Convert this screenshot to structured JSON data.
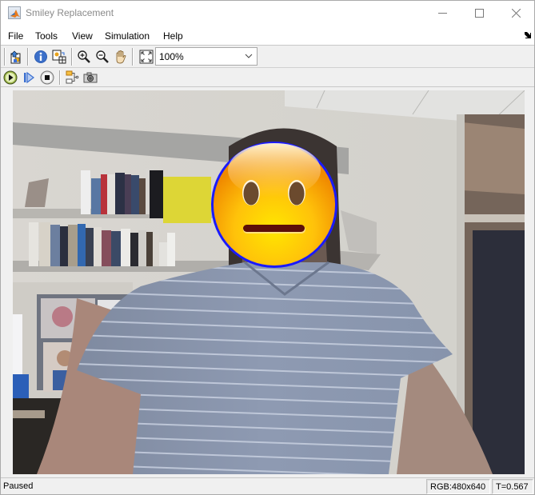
{
  "window": {
    "title": "Smiley Replacement",
    "controls": [
      "minimize",
      "maximize",
      "close"
    ]
  },
  "menubar": {
    "items": [
      {
        "label": "File"
      },
      {
        "label": "Tools"
      },
      {
        "label": "View"
      },
      {
        "label": "Simulation"
      },
      {
        "label": "Help"
      }
    ]
  },
  "toolbar": {
    "buttons": [
      {
        "name": "bring-simulink-to-front",
        "icon": "simulink-front-icon"
      },
      {
        "name": "information",
        "icon": "info-icon"
      },
      {
        "name": "pixel-region",
        "icon": "pixel-region-icon"
      },
      {
        "name": "zoom-in",
        "icon": "zoom-in-icon"
      },
      {
        "name": "zoom-out",
        "icon": "zoom-out-icon"
      },
      {
        "name": "pan",
        "icon": "hand-icon"
      },
      {
        "name": "fit-to-view",
        "icon": "fit-to-view-icon"
      }
    ],
    "zoom_level": "100%"
  },
  "playback": {
    "buttons": [
      {
        "name": "run",
        "icon": "play-icon"
      },
      {
        "name": "step-forward",
        "icon": "step-forward-icon"
      },
      {
        "name": "stop",
        "icon": "stop-icon"
      },
      {
        "name": "highlight-block",
        "icon": "highlight-block-icon"
      },
      {
        "name": "snapshot",
        "icon": "camera-icon"
      }
    ]
  },
  "display": {
    "overlay": "neutral-face-emoji",
    "overlay_outline_color": "#1a1aff"
  },
  "statusbar": {
    "status": "Paused",
    "frame_info": "RGB:480x640",
    "time": "T=0.567"
  }
}
